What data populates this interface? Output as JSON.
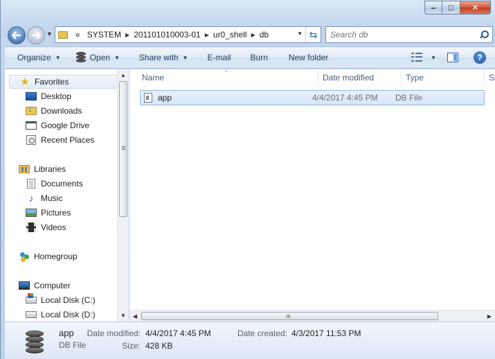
{
  "window": {
    "min_glyph": "–",
    "max_glyph": "□",
    "close_glyph": "✕"
  },
  "address": {
    "overflow": "«",
    "crumbs": [
      "SYSTEM",
      "201101010003-01",
      "ur0_shell",
      "db"
    ]
  },
  "search": {
    "placeholder": "Search db"
  },
  "toolbar": {
    "organize": "Organize",
    "open": "Open",
    "share_with": "Share with",
    "email": "E-mail",
    "burn": "Burn",
    "new_folder": "New folder"
  },
  "nav": {
    "favorites": "Favorites",
    "desktop": "Desktop",
    "downloads": "Downloads",
    "google_drive": "Google Drive",
    "recent_places": "Recent Places",
    "libraries": "Libraries",
    "documents": "Documents",
    "music": "Music",
    "pictures": "Pictures",
    "videos": "Videos",
    "homegroup": "Homegroup",
    "computer": "Computer",
    "local_c": "Local Disk (C:)",
    "local_d": "Local Disk (D:)"
  },
  "columns": [
    "Name",
    "Date modified",
    "Type",
    "Si"
  ],
  "files": [
    {
      "name": "app",
      "date_modified": "4/4/2017 4:45 PM",
      "type": "DB File"
    }
  ],
  "details": {
    "name": "app",
    "type": "DB File",
    "date_modified_label": "Date modified:",
    "date_modified": "4/4/2017 4:45 PM",
    "size_label": "Size:",
    "size": "428 KB",
    "date_created_label": "Date created:",
    "date_created": "4/3/2017 11:53 PM"
  },
  "icons": {
    "back": "back-arrow-icon",
    "forward": "forward-arrow-icon",
    "refresh": "refresh-icon",
    "search": "search-icon",
    "help": "help-icon"
  }
}
